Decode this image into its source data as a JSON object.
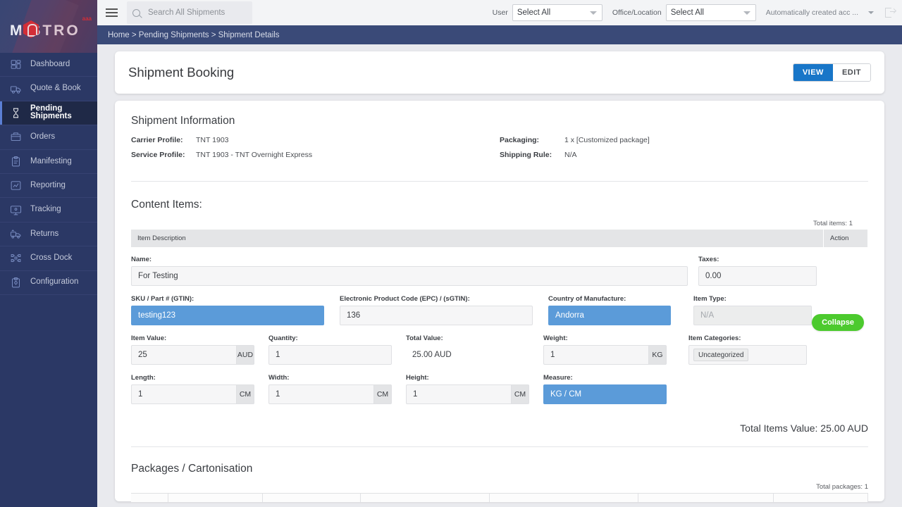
{
  "brand": {
    "logo_text": "M STRO",
    "logo_sup": "aaa",
    "accent_red": "#e02b30"
  },
  "topbar": {
    "search_placeholder": "Search All Shipments",
    "user_label": "User",
    "user_value": "Select All",
    "office_label": "Office/Location",
    "office_value": "Select All",
    "account_value": "Automatically created acc ...",
    "logout_icon": "logout-icon",
    "menu_icon": "hamburger-icon",
    "search_icon": "search-icon"
  },
  "breadcrumb": {
    "text": "Home > Pending Shipments > Shipment Details"
  },
  "sidebar": {
    "items": [
      {
        "label": "Dashboard",
        "icon": "dashboard-icon",
        "active": false
      },
      {
        "label": "Quote & Book",
        "icon": "truck-quote-icon",
        "active": false
      },
      {
        "label": "Pending Shipments",
        "icon": "hourglass-icon",
        "active": true
      },
      {
        "label": "Orders",
        "icon": "box-orders-icon",
        "active": false
      },
      {
        "label": "Manifesting",
        "icon": "clipboard-icon",
        "active": false
      },
      {
        "label": "Reporting",
        "icon": "chart-report-icon",
        "active": false
      },
      {
        "label": "Tracking",
        "icon": "monitor-tracking-icon",
        "active": false
      },
      {
        "label": "Returns",
        "icon": "return-truck-icon",
        "active": false
      },
      {
        "label": "Cross Dock",
        "icon": "cross-dock-icon",
        "active": false
      },
      {
        "label": "Configuration",
        "icon": "config-clipboard-icon",
        "active": false
      }
    ]
  },
  "page": {
    "title": "Shipment Booking",
    "view_label": "VIEW",
    "edit_label": "EDIT",
    "active_mode": "VIEW"
  },
  "shipment_information": {
    "heading": "Shipment Information",
    "left": [
      {
        "key": "Carrier Profile:",
        "value": "TNT 1903"
      },
      {
        "key": "Service Profile:",
        "value": "TNT 1903 - TNT Overnight Express"
      }
    ],
    "right": [
      {
        "key": "Packaging:",
        "value": "1 x [Customized package]"
      },
      {
        "key": "Shipping Rule:",
        "value": "N/A"
      }
    ]
  },
  "content_items": {
    "heading": "Content Items:",
    "total_items": "Total items: 1",
    "col_description": "Item Description",
    "col_action": "Action",
    "collapse_label": "Collapse",
    "fields": {
      "name_label": "Name:",
      "name_value": "For Testing",
      "taxes_label": "Taxes:",
      "taxes_value": "0.00",
      "sku_label": "SKU / Part # (GTIN):",
      "sku_value": "testing123",
      "epc_label": "Electronic Product Code (EPC) / (sGTIN):",
      "epc_value": "136",
      "country_label": "Country of Manufacture:",
      "country_value": "Andorra",
      "item_type_label": "Item Type:",
      "item_type_value": "N/A",
      "item_value_label": "Item Value:",
      "item_value_value": "25",
      "item_value_unit": "AUD",
      "quantity_label": "Quantity:",
      "quantity_value": "1",
      "total_value_label": "Total Value:",
      "total_value_value": "25.00 AUD",
      "weight_label": "Weight:",
      "weight_value": "1",
      "weight_unit": "KG",
      "item_categories_label": "Item Categories:",
      "item_categories_chip": "Uncategorized",
      "length_label": "Length:",
      "length_value": "1",
      "length_unit": "CM",
      "width_label": "Width:",
      "width_value": "1",
      "width_unit": "CM",
      "height_label": "Height:",
      "height_value": "1",
      "height_unit": "CM",
      "measure_label": "Measure:",
      "measure_value": "KG / CM"
    },
    "total_items_value": "Total Items Value: 25.00 AUD"
  },
  "packages": {
    "heading": "Packages / Cartonisation",
    "total_packages": "Total packages: 1"
  },
  "colors": {
    "sidebar_bg": "#2b3865",
    "breadcrumb_bg": "#3a4a78",
    "primary_blue": "#1876c8",
    "selected_field": "#5b9bd9",
    "collapse_green": "#4cca2e",
    "page_bg": "#e9eaee"
  }
}
